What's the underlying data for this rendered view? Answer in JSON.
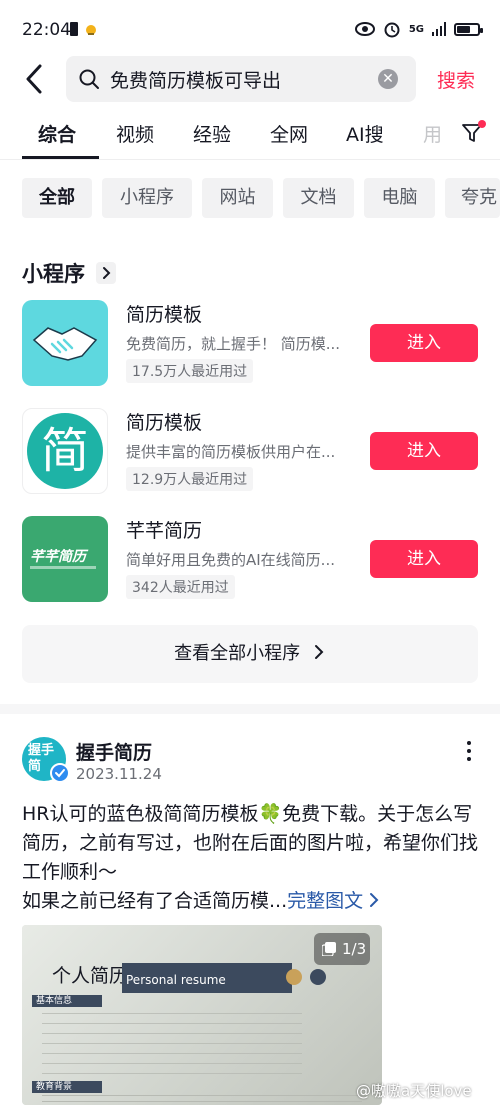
{
  "status": {
    "time": "22:04",
    "network": "5G"
  },
  "search": {
    "query": "免费简历模板可导出",
    "submit_label": "搜索"
  },
  "tabs": [
    "综合",
    "视频",
    "经验",
    "全网",
    "AI搜",
    "用"
  ],
  "chips": [
    "全部",
    "小程序",
    "网站",
    "文档",
    "电脑",
    "夸克"
  ],
  "section": {
    "title": "小程序"
  },
  "apps": [
    {
      "name": "简历模板",
      "desc": "免费简历，就上握手！ 简历模...",
      "usage": "17.5万人最近用过",
      "button": "进入"
    },
    {
      "name": "简历模板",
      "desc": "提供丰富的简历模板供用户在...",
      "usage": "12.9万人最近用过",
      "button": "进入",
      "icon_glyph": "简"
    },
    {
      "name": "芊芊简历",
      "desc": "简单好用且免费的AI在线简历...",
      "usage": "342人最近用过",
      "button": "进入",
      "icon_text": "芊芊简历"
    }
  ],
  "view_all": "查看全部小程序",
  "post": {
    "author": "握手简历",
    "avatar_text": "握手简",
    "date": "2023.11.24",
    "body": "HR认可的蓝色极简简历模板🍀免费下载。关于怎么写简历，之前有写过，也附在后面的图片啦，希望你们找工作顺利～\n如果之前已经有了合适简历模...",
    "more_label": "完整图文",
    "image_counter": "1/3",
    "image_title": "个人简历",
    "image_subtitle": "Personal resume",
    "image_section_1": "基本信息",
    "image_section_2": "教育背景",
    "watermark": "@嗷嗷a天使love"
  },
  "colors": {
    "accent": "#fe2c55",
    "link": "#2a5aa8",
    "teal": "#1fb5c6"
  }
}
